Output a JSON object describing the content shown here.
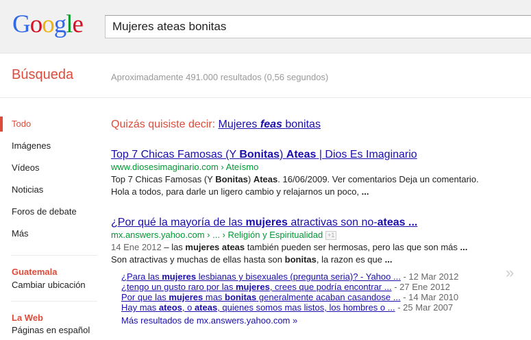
{
  "header": {
    "logo_letters": [
      "G",
      "o",
      "o",
      "g",
      "l",
      "e"
    ],
    "logo_colors": [
      "#3369e8",
      "#d50f25",
      "#eeb211",
      "#3369e8",
      "#009925",
      "#d50f25"
    ],
    "search_value": "Mujeres ateas bonitas"
  },
  "subheader": {
    "title": "Búsqueda",
    "stats": "Aproximadamente 491.000 resultados (0,56 segundos)"
  },
  "sidebar": {
    "items": [
      "Todo",
      "Imágenes",
      "Vídeos",
      "Noticias",
      "Foros de debate",
      "Más"
    ],
    "location_title": "Guatemala",
    "location_change": "Cambiar ubicación",
    "lang_title": "La Web",
    "lang_option": "Páginas en español"
  },
  "didyoumean": {
    "prefix": "Quizás quisiste decir:",
    "link_a": "Mujeres",
    "link_b": "feas",
    "link_c": "bonitas"
  },
  "results": [
    {
      "title_parts": [
        "Top 7 Chicas Famosas (Y ",
        "Bonitas",
        ") ",
        "Ateas",
        " | Dios Es Imaginario"
      ],
      "url": "www.diosesimaginario.com › Ateísmo",
      "snippet_parts": [
        "Top 7 Chicas Famosas (Y ",
        "Bonitas",
        ") ",
        "Ateas",
        ". 16/06/2009. Ver comentarios Deja un comentario. Hola a todos, para darle un ligero cambio y relajarnos un poco, ",
        "..."
      ]
    },
    {
      "title_parts": [
        "¿Por qué la mayoría de las ",
        "mujeres",
        " atractivas son no-",
        "ateas",
        " ..."
      ],
      "url": "mx.answers.yahoo.com › ... › Religión y Espiritualidad",
      "plus_label": "+1",
      "date": "14 Ene 2012",
      "snippet_parts": [
        " – las ",
        "mujeres ateas",
        " también pueden ser hermosas, pero las que son más ",
        "...",
        " Son atractivas y muchas de ellas hasta son ",
        "bonitas",
        ", la razon es que ",
        "..."
      ]
    }
  ],
  "sitelinks": [
    {
      "parts": [
        "¿Para las ",
        "mujeres",
        " lesbianas y bisexuales (pregunta seria)? - Yahoo ..."
      ],
      "date": " - 12 Mar 2012"
    },
    {
      "parts": [
        "¿tengo un gusto raro por las ",
        "mujeres",
        ", crees que podría encontrar ..."
      ],
      "date": " - 27 Ene 2012"
    },
    {
      "parts": [
        "Por que las ",
        "mujeres",
        " mas ",
        "bonitas",
        " generalmente acaban casandose ..."
      ],
      "date": " - 14 Mar 2010"
    },
    {
      "parts": [
        "Hay mas ",
        "ateos",
        ", o ",
        "ateas",
        ", quienes somos mas listos, los hombres o ..."
      ],
      "date": " - 25 Mar 2007"
    }
  ],
  "more_results": "Más resultados de mx.answers.yahoo.com »"
}
